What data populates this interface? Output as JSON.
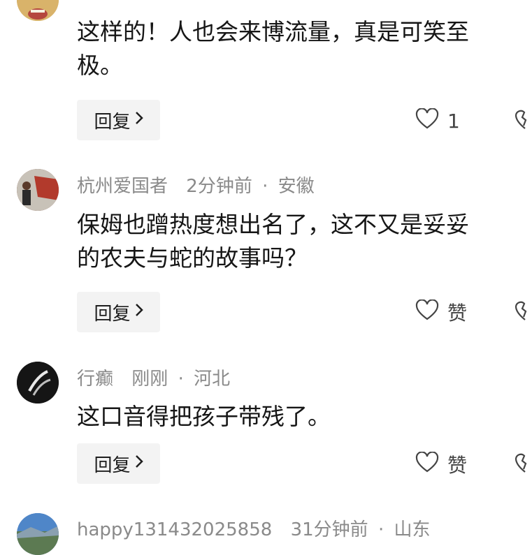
{
  "comments": [
    {
      "user": "",
      "time": "",
      "location": "",
      "text_lines": [
        "这样的！人也会来博流量，真是可笑至",
        "极。"
      ],
      "reply_label": "回复",
      "like_label": "1",
      "avatar_color": "#c9a65a"
    },
    {
      "user": "杭州爱国者",
      "time": "2分钟前",
      "location": "安徽",
      "text_lines": [
        "保姆也蹭热度想出名了，这不又是妥妥",
        "的农夫与蛇的故事吗？"
      ],
      "reply_label": "回复",
      "like_label": "赞",
      "avatar_color": "#7a3b2b"
    },
    {
      "user": "行癫",
      "time": "刚刚",
      "location": "河北",
      "text_lines": [
        "这口音得把孩子带残了。"
      ],
      "reply_label": "回复",
      "like_label": "赞",
      "avatar_color": "#1c1c1c"
    },
    {
      "user": "happy131432025858",
      "time": "31分钟前",
      "location": "山东",
      "avatar_color": "#4a78b8"
    }
  ],
  "separator": "·",
  "colors": {
    "meta": "#8a8a8a",
    "reply_bg": "#f3f3f3",
    "text": "#161616"
  },
  "icons": {
    "like": "heart-outline-icon",
    "dislike": "broken-heart-icon",
    "reply_chevron": "chevron-right-icon"
  }
}
